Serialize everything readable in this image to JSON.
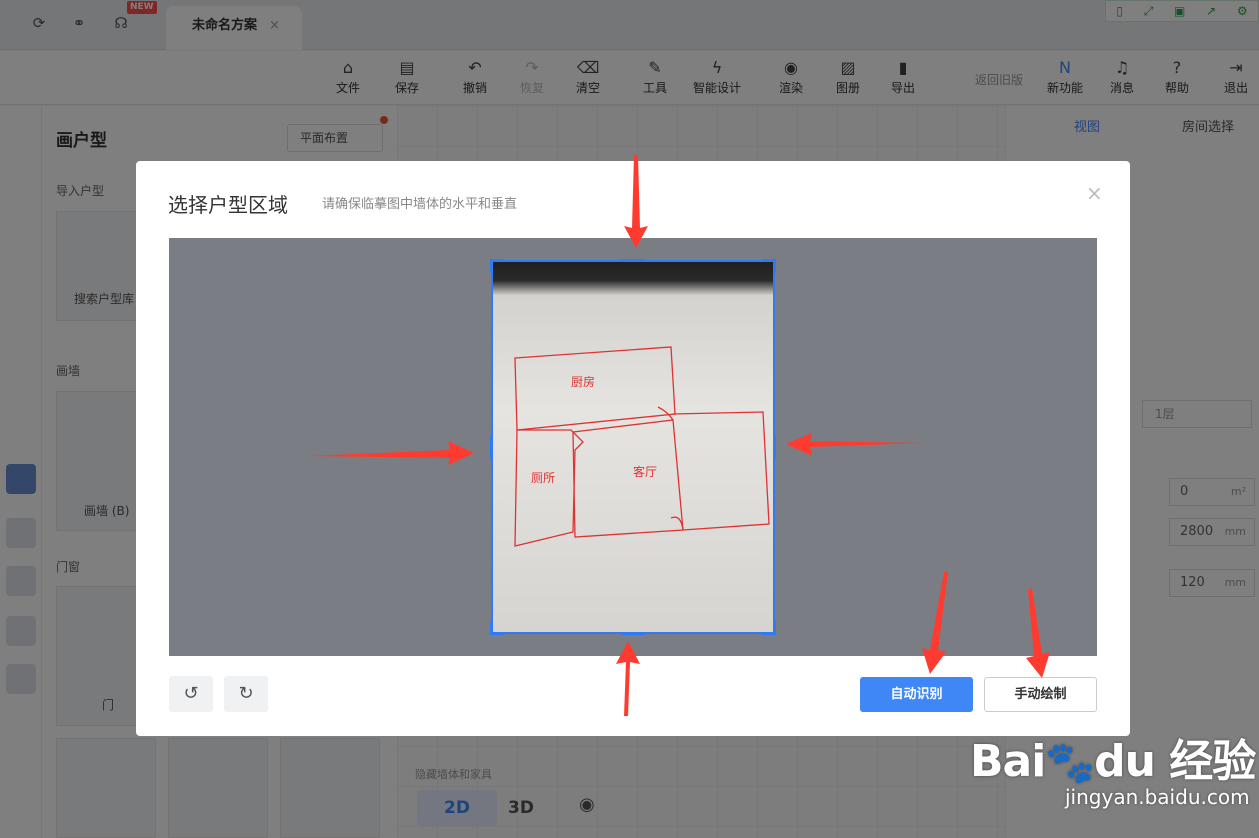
{
  "tabbar": {
    "new_badge": "NEW",
    "doc_tab": "未命名方案",
    "doc_close": "×"
  },
  "toolbar": {
    "items": [
      "文件",
      "保存",
      "撤销",
      "恢复",
      "清空",
      "工具",
      "智能设计",
      "渲染",
      "图册",
      "导出"
    ],
    "back_old": "返回旧版",
    "right_items": [
      "新功能",
      "消息",
      "帮助",
      "退出"
    ]
  },
  "panel": {
    "title": "画户型",
    "tab": "平面布置",
    "import_title": "导入户型",
    "search_label": "搜索户型库",
    "wall_title": "画墙",
    "wall_label": "画墙 (B)",
    "window_title": "门窗",
    "door_label": "门"
  },
  "rpanel": {
    "tab_view": "视图",
    "tab_room": "房间选择",
    "floor": "1层",
    "area": "0",
    "area_unit": "m²",
    "height": "2800",
    "height_unit": "mm",
    "thick": "120",
    "thick_unit": "mm"
  },
  "bottombar": {
    "mode_2d": "2D",
    "mode_3d": "3D",
    "hint": "隐藏墙体和家具"
  },
  "dialog": {
    "title": "选择户型区域",
    "subtitle": "请确保临摹图中墙体的水平和垂直",
    "close": "×",
    "auto_btn": "自动识别",
    "manual_btn": "手动绘制",
    "sketch_labels": [
      "厨房",
      "厕所",
      "客厅"
    ]
  },
  "watermark": {
    "logo": "Bai du 经验",
    "url": "jingyan.baidu.com"
  },
  "colors": {
    "accent": "#3f86f7",
    "arrow": "#ff3b30",
    "sketch": "#d33"
  }
}
